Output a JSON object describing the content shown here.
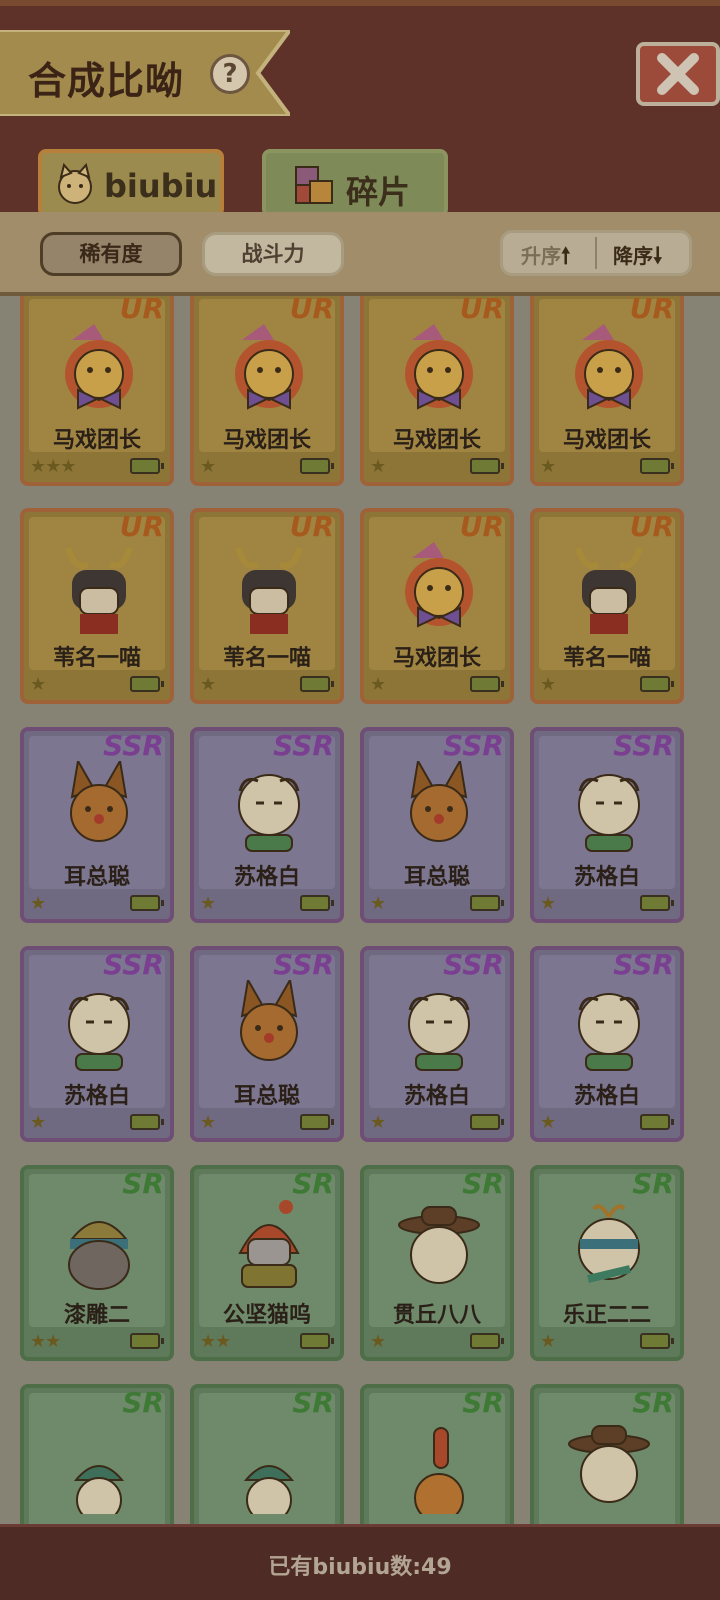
{
  "header": {
    "title": "合成比呦",
    "help_symbol": "?",
    "close_icon": "close-icon"
  },
  "tabs": [
    {
      "label": "biubiu",
      "icon": "cat-icon",
      "active": true
    },
    {
      "label": "碎片",
      "icon": "fragment-icon",
      "active": false
    }
  ],
  "sort": {
    "rarity_label": "稀有度",
    "power_label": "战斗力",
    "asc_label": "升序",
    "desc_label": "降序",
    "asc_arrow": "🠕",
    "desc_arrow": "🠗",
    "active": "rarity"
  },
  "cards": [
    {
      "rarity": "UR",
      "name": "马戏团长",
      "stars": "★★★",
      "char": "lion"
    },
    {
      "rarity": "UR",
      "name": "马戏团长",
      "stars": "★",
      "char": "lion"
    },
    {
      "rarity": "UR",
      "name": "马戏团长",
      "stars": "★",
      "char": "lion"
    },
    {
      "rarity": "UR",
      "name": "马戏团长",
      "stars": "★",
      "char": "lion"
    },
    {
      "rarity": "UR",
      "name": "苇名一喵",
      "stars": "★",
      "char": "samurai"
    },
    {
      "rarity": "UR",
      "name": "苇名一喵",
      "stars": "★",
      "char": "samurai"
    },
    {
      "rarity": "UR",
      "name": "马戏团长",
      "stars": "★",
      "char": "lion"
    },
    {
      "rarity": "UR",
      "name": "苇名一喵",
      "stars": "★",
      "char": "samurai"
    },
    {
      "rarity": "SSR",
      "name": "耳总聪",
      "stars": "★",
      "char": "caracal"
    },
    {
      "rarity": "SSR",
      "name": "苏格白",
      "stars": "★",
      "char": "fold"
    },
    {
      "rarity": "SSR",
      "name": "耳总聪",
      "stars": "★",
      "char": "caracal"
    },
    {
      "rarity": "SSR",
      "name": "苏格白",
      "stars": "★",
      "char": "fold"
    },
    {
      "rarity": "SSR",
      "name": "苏格白",
      "stars": "★",
      "char": "fold"
    },
    {
      "rarity": "SSR",
      "name": "耳总聪",
      "stars": "★",
      "char": "caracal"
    },
    {
      "rarity": "SSR",
      "name": "苏格白",
      "stars": "★",
      "char": "fold"
    },
    {
      "rarity": "SSR",
      "name": "苏格白",
      "stars": "★",
      "char": "fold"
    },
    {
      "rarity": "SR",
      "name": "漆雕二",
      "stars": "★★",
      "char": "seal"
    },
    {
      "rarity": "SR",
      "name": "公坚猫呜",
      "stars": "★★",
      "char": "helmet"
    },
    {
      "rarity": "SR",
      "name": "贯丘八八",
      "stars": "★",
      "char": "hat"
    },
    {
      "rarity": "SR",
      "name": "乐正二二",
      "stars": "★",
      "char": "sprout"
    },
    {
      "rarity": "SR",
      "name": "",
      "stars": "",
      "char": "cap"
    },
    {
      "rarity": "SR",
      "name": "",
      "stars": "",
      "char": "cap"
    },
    {
      "rarity": "SR",
      "name": "",
      "stars": "",
      "char": "finger"
    },
    {
      "rarity": "SR",
      "name": "",
      "stars": "",
      "char": "hat"
    }
  ],
  "footer": {
    "count_text": "已有biubiu数:49"
  },
  "colors": {
    "ur_border": "#9f6238",
    "ssr_border": "#6f4e75",
    "sr_border": "#4d6e47",
    "header_bg": "#5e3129"
  }
}
